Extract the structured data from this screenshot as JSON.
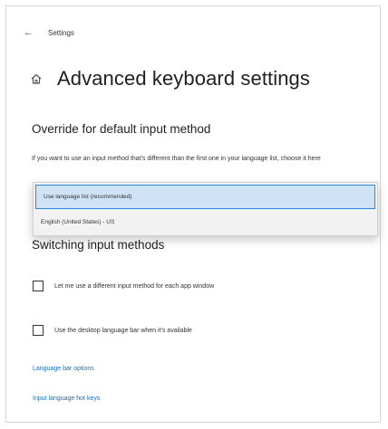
{
  "window": {
    "title": "Settings"
  },
  "page": {
    "title": "Advanced keyboard settings"
  },
  "override": {
    "heading": "Override for default input method",
    "description": "If you want to use an input method that's different than the first one in your language list, choose it here",
    "options": [
      "Use language list (recommended)",
      "English (United States) - US"
    ],
    "selected_index": 0
  },
  "switching": {
    "heading": "Switching input methods",
    "checkboxes": [
      {
        "label": "Let me use a different input method for each app window",
        "checked": false
      },
      {
        "label": "Use the desktop language bar when it's available",
        "checked": false
      }
    ]
  },
  "links": {
    "language_bar_options": "Language bar options",
    "input_language_hot_keys": "Input language hot keys"
  },
  "colors": {
    "accent": "#2b88d8",
    "link": "#1a6fb8",
    "selection": "#cfe3f7"
  },
  "icons": {
    "back": "back-arrow-icon",
    "home": "home-icon"
  }
}
